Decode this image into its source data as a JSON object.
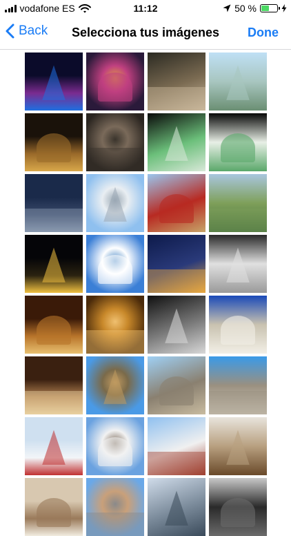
{
  "status_bar": {
    "carrier": "vodafone ES",
    "time": "11:12",
    "battery_percent": "50 %",
    "battery_level": 0.5,
    "icons": [
      "signal-icon",
      "wifi-icon",
      "location-icon",
      "battery-icon",
      "charging-icon"
    ]
  },
  "nav": {
    "back_label": "Back",
    "title": "Selecciona tus imágenes",
    "done_label": "Done"
  },
  "colors": {
    "accent": "#1a7cf5",
    "battery_fill": "#4cd964",
    "divider": "#d6d6d9"
  },
  "photos": [
    {
      "subject": "shanghai-skyline-night",
      "colors": [
        "#0b0b2a",
        "#7a2b8f",
        "#1f6fe0"
      ]
    },
    {
      "subject": "pearl-tower-night",
      "colors": [
        "#2a1a3a",
        "#c04080",
        "#e0a040"
      ]
    },
    {
      "subject": "restaurant-dish",
      "colors": [
        "#2b2a22",
        "#7b6b52",
        "#c9b79b"
      ]
    },
    {
      "subject": "palace-garden-pool",
      "colors": [
        "#bfe0f5",
        "#6b8f73",
        "#a8c6c0"
      ]
    },
    {
      "subject": "golden-buddha",
      "colors": [
        "#1a120a",
        "#9a6a2a",
        "#d9a84a"
      ]
    },
    {
      "subject": "bronze-sculpture",
      "colors": [
        "#2a2520",
        "#7a6a5a",
        "#3a342c"
      ]
    },
    {
      "subject": "jade-cabbage",
      "colors": [
        "#0a0a0a",
        "#6bbf7a",
        "#d8e8d8"
      ]
    },
    {
      "subject": "jade-cabbage-closeup",
      "colors": [
        "#080808",
        "#5aa86a",
        "#e8efe6"
      ]
    },
    {
      "subject": "dusk-cityscape",
      "colors": [
        "#1a2a4a",
        "#3a4a6a",
        "#8a9ab0"
      ]
    },
    {
      "subject": "memorial-hall",
      "colors": [
        "#8fc0ef",
        "#e9eef2",
        "#9aa8b4"
      ]
    },
    {
      "subject": "chinese-temple",
      "colors": [
        "#9ac6ee",
        "#b82a22",
        "#c7a468"
      ]
    },
    {
      "subject": "forest-park",
      "colors": [
        "#a9c6de",
        "#3f6a3a",
        "#7fa05a"
      ]
    },
    {
      "subject": "eiffel-tower-night",
      "colors": [
        "#050508",
        "#2a2210",
        "#f0c040"
      ]
    },
    {
      "subject": "reflecting-lake",
      "colors": [
        "#3b7fd6",
        "#ffffff",
        "#4a88c6"
      ]
    },
    {
      "subject": "louvre-pyramid-night",
      "colors": [
        "#0d1a4a",
        "#2a3a7a",
        "#e8a840"
      ]
    },
    {
      "subject": "ornate-dome-bw",
      "colors": [
        "#2a2a2a",
        "#9a9a9a",
        "#e0e0e0"
      ]
    },
    {
      "subject": "opera-interior",
      "colors": [
        "#3a1a08",
        "#b8742a",
        "#e8c070"
      ]
    },
    {
      "subject": "golden-hall",
      "colors": [
        "#4a2a0a",
        "#c8882a",
        "#f0c070"
      ]
    },
    {
      "subject": "columns-bw",
      "colors": [
        "#101010",
        "#7a7a7a",
        "#d8d8d8"
      ]
    },
    {
      "subject": "sacre-coeur",
      "colors": [
        "#1a4ab8",
        "#f2efe6",
        "#c9c2b0"
      ]
    },
    {
      "subject": "church-interior",
      "colors": [
        "#3a2010",
        "#b08050",
        "#e8d0a0"
      ]
    },
    {
      "subject": "eiffel-tower-day",
      "colors": [
        "#4a9ae6",
        "#7a6a4a",
        "#c09a60"
      ]
    },
    {
      "subject": "notre-dame",
      "colors": [
        "#9fd0f5",
        "#8a8070",
        "#c8bba0"
      ]
    },
    {
      "subject": "arc-de-triomphe",
      "colors": [
        "#3a9ae8",
        "#d8d0c0",
        "#9a9080"
      ]
    },
    {
      "subject": "flags-sky",
      "colors": [
        "#cfe0f0",
        "#f2f5f8",
        "#c03030"
      ]
    },
    {
      "subject": "colonial-house",
      "colors": [
        "#6aa2e0",
        "#f2f2f2",
        "#7a6a5a"
      ]
    },
    {
      "subject": "church-steeple",
      "colors": [
        "#8fc0f0",
        "#f0f0f0",
        "#a04030"
      ]
    },
    {
      "subject": "train-station",
      "colors": [
        "#e8e4dc",
        "#6a4a2a",
        "#b8a080"
      ]
    },
    {
      "subject": "ornate-ceiling",
      "colors": [
        "#d8c8b0",
        "#9a7a5a",
        "#f2ece0"
      ]
    },
    {
      "subject": "skyscrapers",
      "colors": [
        "#6aa8e8",
        "#c9a07a",
        "#8a8a8a"
      ]
    },
    {
      "subject": "city-skyline",
      "colors": [
        "#d0dcea",
        "#7a8a9a",
        "#3a4a5a"
      ]
    },
    {
      "subject": "empire-state-bw",
      "colors": [
        "#c8c8c8",
        "#6a6a6a",
        "#2a2a2a"
      ]
    }
  ]
}
